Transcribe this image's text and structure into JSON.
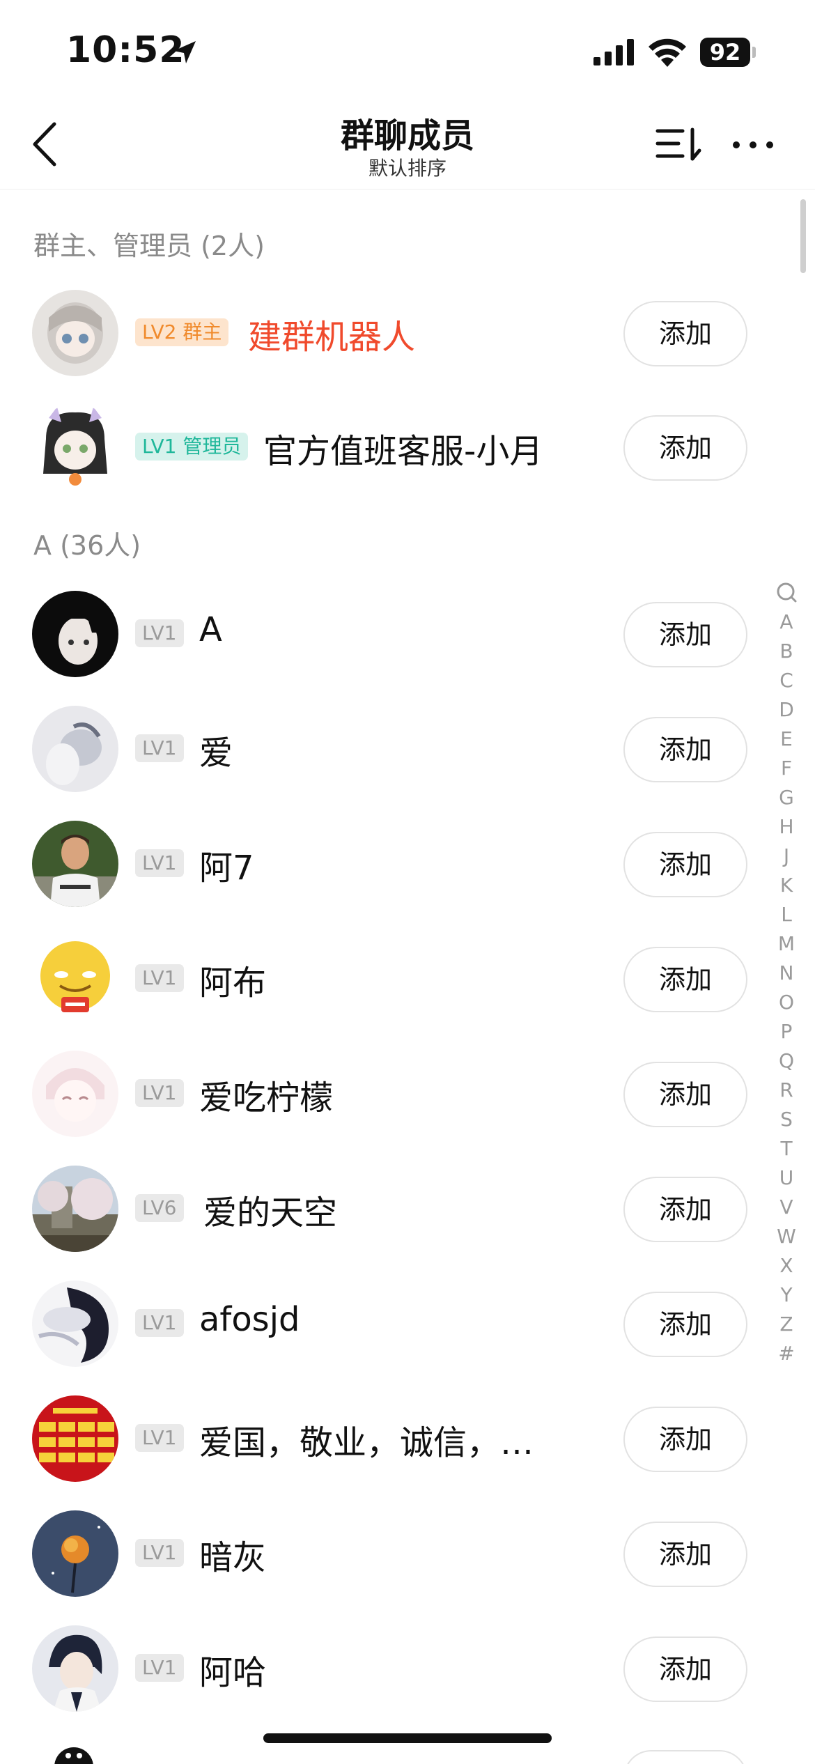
{
  "status_bar": {
    "time": "10:52",
    "battery": "92"
  },
  "nav": {
    "title": "群聊成员",
    "subtitle": "默认排序"
  },
  "sections": [
    {
      "header": "群主、管理员 (2人)"
    },
    {
      "header": "A (36人)"
    }
  ],
  "members": [
    {
      "level": "LV2 群主",
      "name": "建群机器人",
      "badge_style": "orange",
      "action": "添加"
    },
    {
      "level": "LV1 管理员",
      "name": "官方值班客服-小月",
      "badge_style": "teal",
      "action": "添加"
    },
    {
      "level": "LV1",
      "name": "A",
      "badge_style": "gray",
      "action": "添加"
    },
    {
      "level": "LV1",
      "name": "爱",
      "badge_style": "gray",
      "action": "添加"
    },
    {
      "level": "LV1",
      "name": "阿7",
      "badge_style": "gray",
      "action": "添加"
    },
    {
      "level": "LV1",
      "name": "阿布",
      "badge_style": "gray",
      "action": "添加"
    },
    {
      "level": "LV1",
      "name": "爱吃柠檬",
      "badge_style": "gray",
      "action": "添加"
    },
    {
      "level": "LV6",
      "name": "爱的天空",
      "badge_style": "gray",
      "action": "添加"
    },
    {
      "level": "LV1",
      "name": "afosjd",
      "badge_style": "gray",
      "action": "添加"
    },
    {
      "level": "LV1",
      "name": "爱国，敬业，诚信，…",
      "badge_style": "gray",
      "action": "添加"
    },
    {
      "level": "LV1",
      "name": "暗灰",
      "badge_style": "gray",
      "action": "添加"
    },
    {
      "level": "LV1",
      "name": "阿哈",
      "badge_style": "gray",
      "action": "添加"
    }
  ],
  "index_bar": [
    "A",
    "B",
    "C",
    "D",
    "E",
    "F",
    "G",
    "H",
    "J",
    "K",
    "L",
    "M",
    "N",
    "O",
    "P",
    "Q",
    "R",
    "S",
    "T",
    "U",
    "V",
    "W",
    "X",
    "Y",
    "Z",
    "#"
  ],
  "colors": {
    "owner_name": "#f04a2c",
    "owner_badge": "#f08a2c",
    "admin_badge": "#1fb79a",
    "level_badge": "#9a9a9a"
  }
}
